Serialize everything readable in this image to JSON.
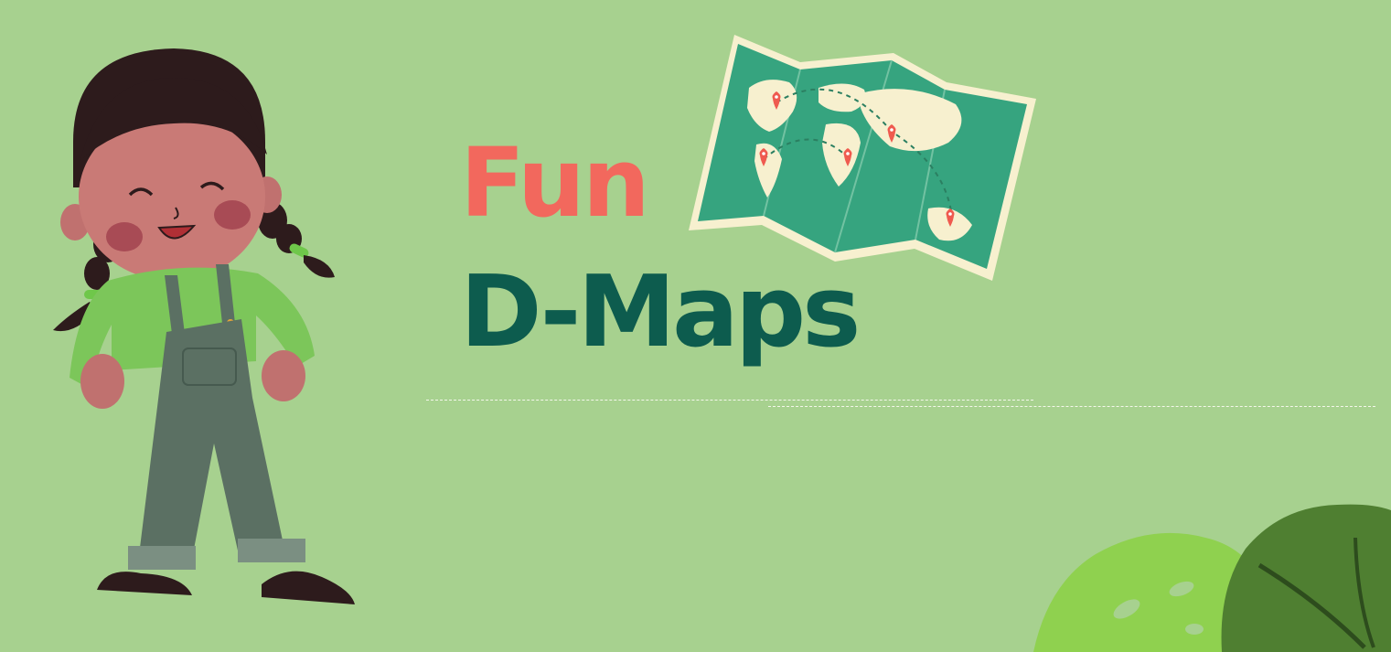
{
  "title": {
    "line1": "Fun",
    "line2": "D-Maps"
  },
  "icons": {
    "character": "girl-character-illustration",
    "map": "world-map-icon",
    "pins": "map-pin-icon",
    "leaves": "monstera-leaf-icon"
  },
  "colors": {
    "background": "#a7d18f",
    "fun_text": "#f2685d",
    "dmaps_text": "#0d5c4e",
    "map_green": "#36a47f",
    "map_land": "#f7f0cf",
    "pin_red": "#ef5a4f",
    "leaf_light": "#8fd14f",
    "leaf_dark": "#4f7f31",
    "divider": "#f3f7ea"
  }
}
